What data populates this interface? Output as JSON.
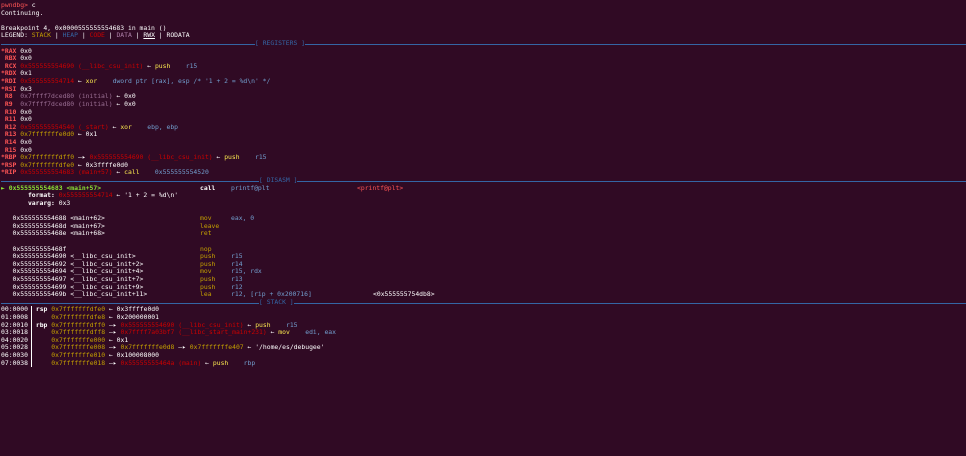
{
  "prompt": {
    "name": "pwndbg>",
    "cmd": " c"
  },
  "continuing": "Continuing.",
  "breakpoint": "Breakpoint 4, 0x0000555555554683 in main ()",
  "legend": {
    "label": "LEGEND: ",
    "stack": "STACK",
    "heap": "HEAP",
    "code": "CODE",
    "data": "DATA",
    "rwx": "RWX",
    "rodata": "RODATA",
    "sep": " | "
  },
  "sections": {
    "registers": "[ REGISTERS ]",
    "disasm": "[ DISASM ]",
    "stack": "[ STACK ]"
  },
  "registers": [
    {
      "name": "*RAX",
      "val": "0x0"
    },
    {
      "name": " RBX",
      "val": "0x0"
    },
    {
      "name": " RCX",
      "addr": "0x555555554690",
      "sym": "(__libc_csu_init)",
      "arrow": "←",
      "op": "push",
      "args": "r15"
    },
    {
      "name": "*RDX",
      "val": "0x1"
    },
    {
      "name": "*RDI",
      "addr": "0x555555554714",
      "arrow": "←",
      "op": "xor",
      "args": "dword ptr [rax], esp /* '1 + 2 = %d\\n' */"
    },
    {
      "name": "*RSI",
      "val": "0x3"
    },
    {
      "name": " R8",
      "addr": "0x7ffff7dced80",
      "sym": "(initial)",
      "arrow": "←",
      "tail": "0x0"
    },
    {
      "name": " R9",
      "addr": "0x7ffff7dced80",
      "sym": "(initial)",
      "arrow": "←",
      "tail": "0x0"
    },
    {
      "name": " R10",
      "val": "0x0"
    },
    {
      "name": " R11",
      "val": "0x0"
    },
    {
      "name": " R12",
      "addr": "0x555555554540",
      "sym": "(_start)",
      "arrow": "←",
      "op": "xor",
      "args": "ebp, ebp"
    },
    {
      "name": " R13",
      "stack": "0x7fffffffe0d0",
      "arrow": "←",
      "tail": "0x1"
    },
    {
      "name": " R14",
      "val": "0x0"
    },
    {
      "name": " R15",
      "val": "0x0"
    },
    {
      "name": "*RBP",
      "stack": "0x7fffffffdff0",
      "arrow2": "—▸",
      "addr": "0x555555554690",
      "sym": "(__libc_csu_init)",
      "arrow": "←",
      "op": "push",
      "args": "r15"
    },
    {
      "name": "*RSP",
      "stack": "0x7fffffffdfe0",
      "arrow": "←",
      "tail": "0x3ffffe0d0"
    },
    {
      "name": "*RIP",
      "addr": "0x555555554683",
      "sym": "(main+57)",
      "arrow": "←",
      "op": "call",
      "args": "0x555555554520"
    }
  ],
  "disasm": {
    "current": {
      "marker": "►",
      "addr": "0x555555554683",
      "sym": "<main+57>",
      "op": "call",
      "target": "printf@plt",
      "ref": "<printf@plt>"
    },
    "format": {
      "label": "format:",
      "addr": "0x555555554714",
      "arrow": "←",
      "str": "'1 + 2 = %d\\n'"
    },
    "vararg": {
      "label": "vararg:",
      "val": "0x3"
    },
    "lines": [
      {
        "addr": "0x555555554688",
        "sym": "<main+62>",
        "op": "mov",
        "args": "eax, 0"
      },
      {
        "addr": "0x55555555468d",
        "sym": "<main+67>",
        "op": "leave",
        "args": ""
      },
      {
        "addr": "0x55555555468e",
        "sym": "<main+68>",
        "op": "ret",
        "args": ""
      },
      {
        "addr": "",
        "sym": "",
        "op": "",
        "args": ""
      },
      {
        "addr": "0x55555555468f",
        "sym": "",
        "op": "nop",
        "args": ""
      },
      {
        "addr": "0x555555554690",
        "sym": "<__libc_csu_init>",
        "op": "push",
        "args": "r15"
      },
      {
        "addr": "0x555555554692",
        "sym": "<__libc_csu_init+2>",
        "op": "push",
        "args": "r14"
      },
      {
        "addr": "0x555555554694",
        "sym": "<__libc_csu_init+4>",
        "op": "mov",
        "args": "r15, rdx"
      },
      {
        "addr": "0x555555554697",
        "sym": "<__libc_csu_init+7>",
        "op": "push",
        "args": "r13"
      },
      {
        "addr": "0x555555554699",
        "sym": "<__libc_csu_init+9>",
        "op": "push",
        "args": "r12"
      },
      {
        "addr": "0x55555555469b",
        "sym": "<__libc_csu_init+11>",
        "op": "lea",
        "args": "r12, [rip + 0x200716]",
        "ref": "<0x555555754db8>"
      }
    ]
  },
  "stack": [
    {
      "idx": "00:0000",
      "reg": "rsp",
      "addr": "0x7fffffffdfe0",
      "chain": "← 0x3ffffe0d0"
    },
    {
      "idx": "01:0008",
      "reg": "",
      "addr": "0x7fffffffdfe8",
      "chain": "← 0x200000001"
    },
    {
      "idx": "02:0010",
      "reg": "rbp",
      "addr": "0x7fffffffdff0",
      "link": "0x555555554690",
      "sym": "(__libc_csu_init)",
      "op": "push",
      "args": "r15"
    },
    {
      "idx": "03:0018",
      "reg": "",
      "addr": "0x7fffffffdff8",
      "link": "0x7ffff7a03bf7",
      "sym": "(__libc_start_main+231)",
      "op": "mov",
      "args": "edi, eax"
    },
    {
      "idx": "04:0020",
      "reg": "",
      "addr": "0x7fffffffe000",
      "chain": "← 0x1"
    },
    {
      "idx": "05:0028",
      "reg": "",
      "addr": "0x7fffffffe008",
      "link2": "0x7fffffffe0d8",
      "link3": "0x7fffffffe407",
      "str": "'/home/es/debugee'"
    },
    {
      "idx": "06:0030",
      "reg": "",
      "addr": "0x7fffffffe010",
      "chain": "← 0x100008000"
    },
    {
      "idx": "07:0038",
      "reg": "",
      "addr": "0x7fffffffe018",
      "link": "0x55555555464a",
      "sym": "(main)",
      "op": "push",
      "args": "rbp"
    }
  ]
}
